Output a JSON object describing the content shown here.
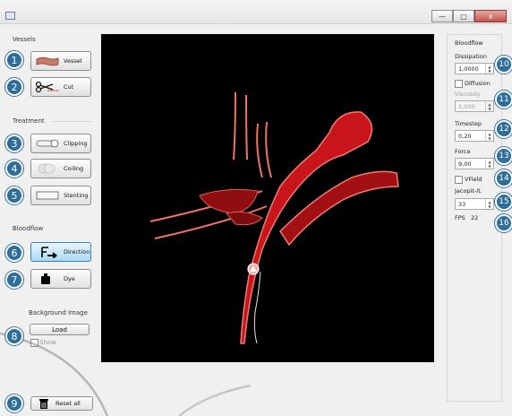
{
  "window": {
    "minimize_glyph": "—",
    "maximize_glyph": "□",
    "close_glyph": "x"
  },
  "left": {
    "vessels_title": "Vessels",
    "vessel_label": "Vessel",
    "cut_label": "Cut",
    "treatment_title": "Treatment",
    "clipping_label": "Clipping",
    "coiling_label": "Coiling",
    "stenting_label": "Stenting",
    "bloodflow_title": "Bloodflow",
    "direction_label": "Direction",
    "dye_label": "Dye",
    "bg_title": "Background Image",
    "load_label": "Load",
    "show_label": "Show",
    "reset_label": "Reset all"
  },
  "right": {
    "title": "Bloodflow",
    "dissipation_label": "Dissipation",
    "dissipation_value": "1,0000",
    "diffusion_label": "Diffusion",
    "viscosity_label": "Viscosity",
    "viscosity_value": "1,000",
    "timestep_label": "Timestep",
    "timestep_value": "0,20",
    "force_label": "Force",
    "force_value": "9,00",
    "vfield_label": "VField",
    "jacobi_label": "Jacopit-It.",
    "jacobi_value": "33",
    "fps_label": "FPS",
    "fps_value": "22"
  },
  "badges": [
    "1",
    "2",
    "3",
    "4",
    "5",
    "6",
    "7",
    "8",
    "9",
    "10",
    "11",
    "12",
    "13",
    "14",
    "15",
    "16"
  ],
  "colors": {
    "accent": "#2f6e9a",
    "vessel_red": "#e0241a",
    "active_button": "#a9d9f6"
  }
}
